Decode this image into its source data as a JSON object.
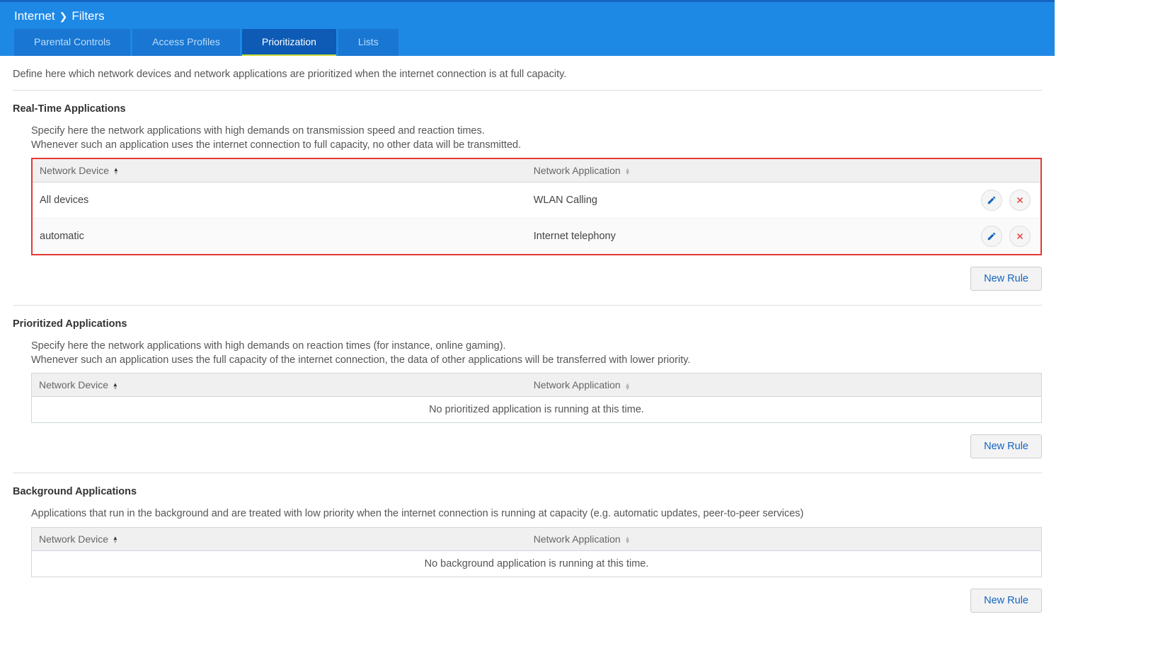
{
  "breadcrumb": {
    "parent": "Internet",
    "current": "Filters"
  },
  "tabs": [
    {
      "label": "Parental Controls"
    },
    {
      "label": "Access Profiles"
    },
    {
      "label": "Prioritization"
    },
    {
      "label": "Lists"
    }
  ],
  "intro": "Define here which network devices and network applications are prioritized when the internet connection is at full capacity.",
  "columns": {
    "device": "Network Device",
    "app": "Network Application"
  },
  "buttons": {
    "new_rule": "New Rule"
  },
  "realtime": {
    "title": "Real-Time Applications",
    "desc1": "Specify here the network applications with high demands on transmission speed and reaction times.",
    "desc2": "Whenever such an application uses the internet connection to full capacity, no other data will be transmitted.",
    "rows": [
      {
        "device": "All devices",
        "app": "WLAN Calling"
      },
      {
        "device": "automatic",
        "app": "Internet telephony"
      }
    ]
  },
  "prioritized": {
    "title": "Prioritized Applications",
    "desc1": "Specify here the network applications with high demands on reaction times (for instance, online gaming).",
    "desc2": "Whenever such an application uses the full capacity of the internet connection, the data of other applications will be transferred with lower priority.",
    "empty": "No prioritized application is running at this time."
  },
  "background": {
    "title": "Background Applications",
    "desc1": "Applications that run in the background and are treated with low priority when the internet connection is running at capacity (e.g. automatic updates, peer-to-peer services)",
    "empty": "No background application is running at this time."
  }
}
